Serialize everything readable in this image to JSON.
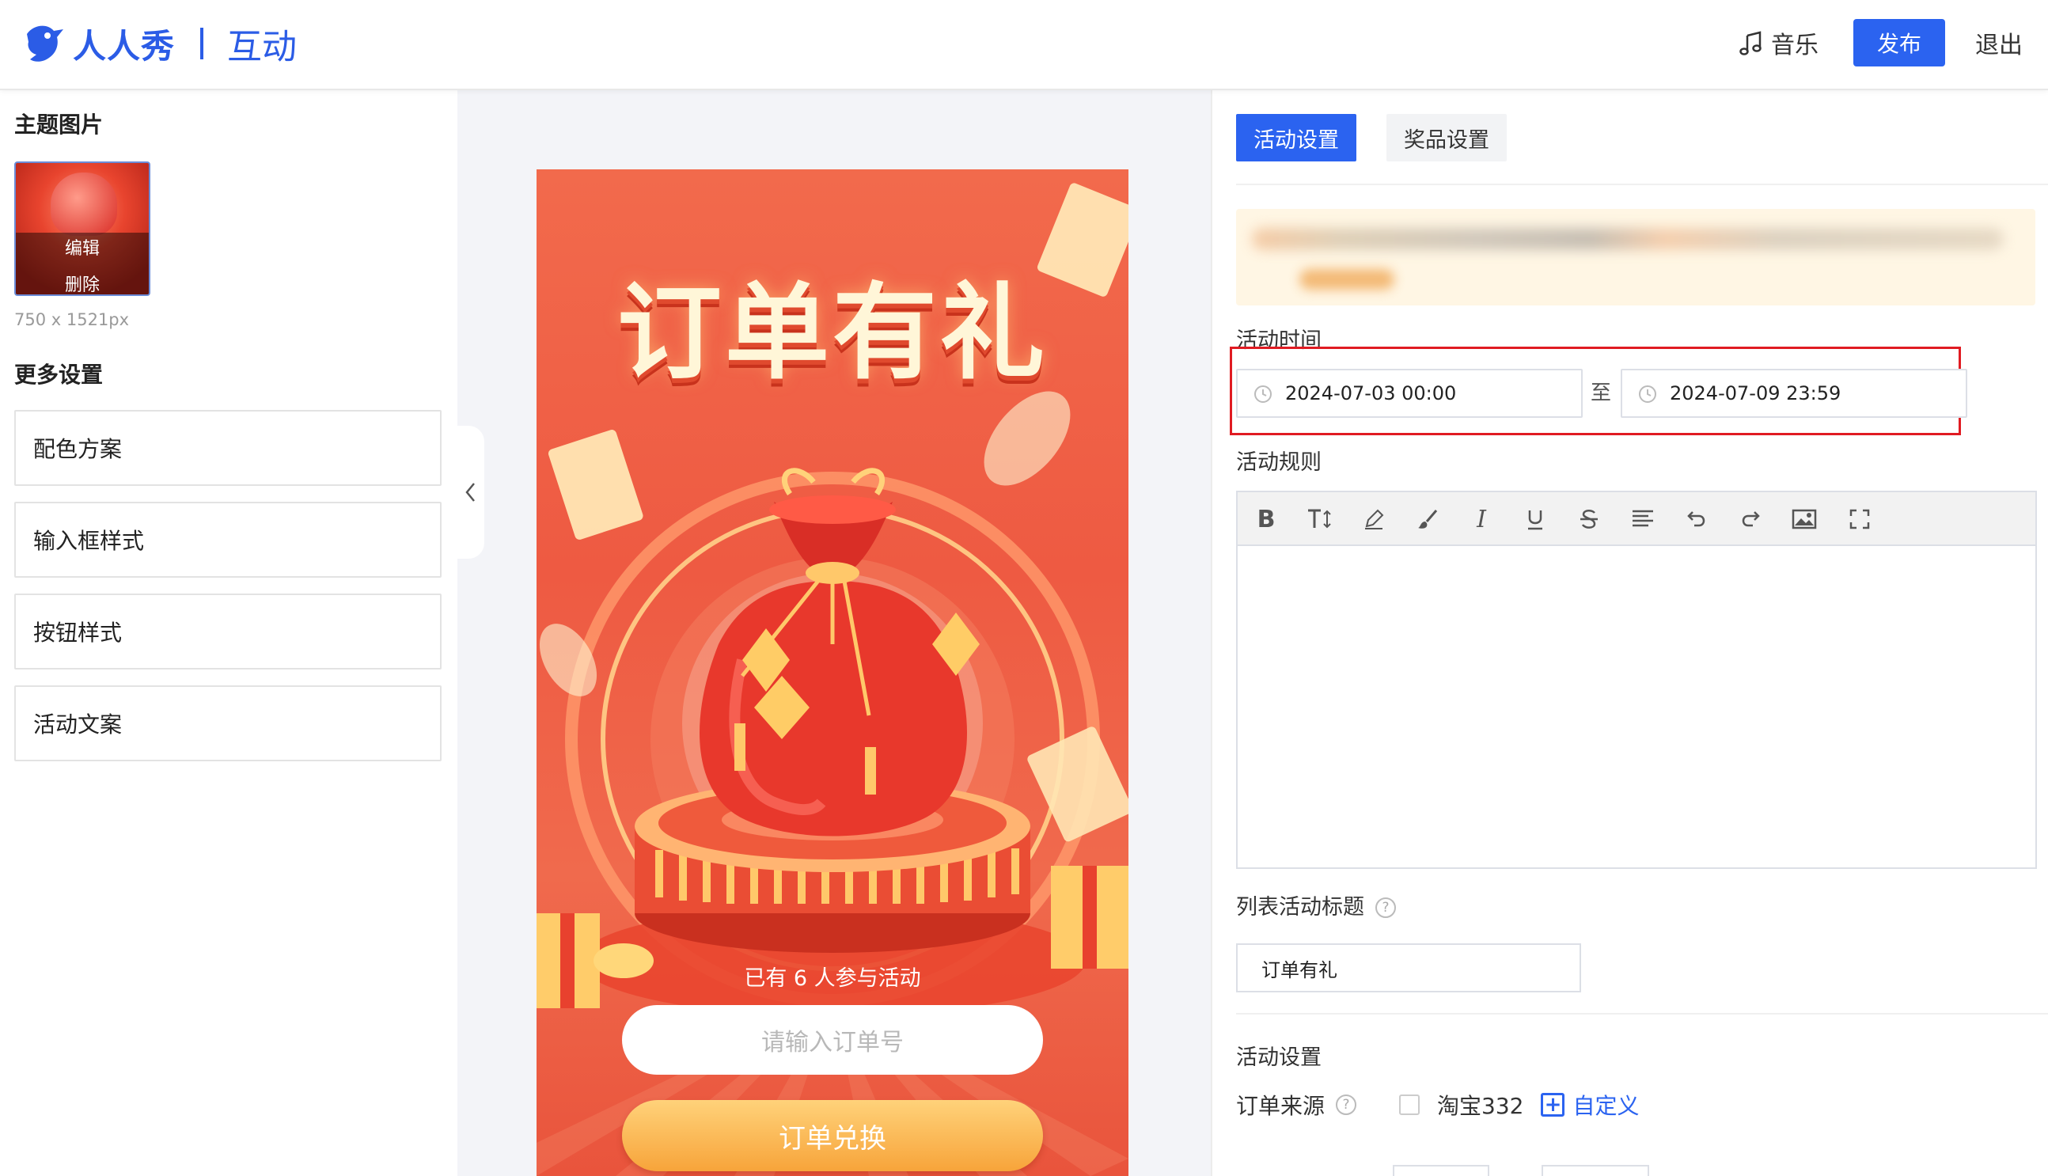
{
  "header": {
    "brand": "人人秀",
    "subtitle": "互动",
    "music_label": "音乐",
    "publish_label": "发布",
    "exit_label": "退出",
    "brand_color": "#2b5ce6"
  },
  "left": {
    "theme_image_title": "主题图片",
    "thumb_edit": "编辑",
    "thumb_delete": "删除",
    "image_size": "750 x 1521px",
    "more_settings_title": "更多设置",
    "options": [
      "配色方案",
      "输入框样式",
      "按钮样式",
      "活动文案"
    ]
  },
  "preview": {
    "title": "订单有礼",
    "participants": "已有 6 人参与活动",
    "input_placeholder": "请输入订单号",
    "button_label": "订单兑换"
  },
  "right": {
    "tabs": [
      "活动设置",
      "奖品设置"
    ],
    "activity_time_label": "活动时间",
    "start_time": "2024-07-03 00:00",
    "to_label": "至",
    "end_time": "2024-07-09 23:59",
    "rules_label": "活动规则",
    "toolbar_icons": [
      "bold-icon",
      "text-size-icon",
      "pen-icon",
      "brush-icon",
      "italic-icon",
      "underline-icon",
      "strikethrough-icon",
      "align-icon",
      "undo-icon",
      "redo-icon",
      "image-icon",
      "fullscreen-icon"
    ],
    "list_title_label": "列表活动标题",
    "list_title_value": "订单有礼",
    "settings_title": "活动设置",
    "order_source_label": "订单来源",
    "source_option": "淘宝332",
    "custom_label": "自定义",
    "accent_color": "#2b63f0",
    "highlight_color": "#e01b22"
  }
}
